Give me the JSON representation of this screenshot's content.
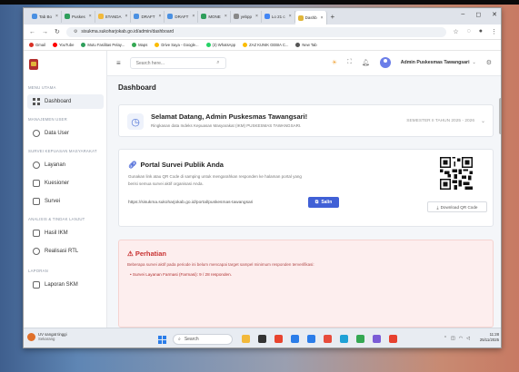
{
  "browser": {
    "tabs": [
      {
        "label": "Tab Bo",
        "active": false
      },
      {
        "label": "Puskes",
        "active": false
      },
      {
        "label": "STANDA",
        "active": false
      },
      {
        "label": "DRAFT",
        "active": false
      },
      {
        "label": "DRAFT",
        "active": false
      },
      {
        "label": "MONE",
        "active": false
      },
      {
        "label": "yebpp",
        "active": false
      },
      {
        "label": "Lo 21 c",
        "active": false
      },
      {
        "label": "Dashb",
        "active": true
      }
    ],
    "url": "sisukma.sukoharjokab.go.id/admin/dashboard",
    "bookmarks": [
      "Gmail",
      "YouTube",
      "Mutu Fasilitas Pelay...",
      "Maps",
      "Drive Saya - Google...",
      "(3) WhatsApp",
      "ZAZ KUNIK GEBIA C...",
      "New Tab"
    ]
  },
  "sidebar": {
    "sections": [
      {
        "heading": "MENU UTAMA",
        "items": [
          {
            "label": "Dashboard",
            "icon": "grid-icon",
            "active": true
          }
        ]
      },
      {
        "heading": "MANAJEMEN USER",
        "items": [
          {
            "label": "Data User",
            "icon": "users-icon",
            "active": false
          }
        ]
      },
      {
        "heading": "SURVEI KEPUASAN MASYARAKAT",
        "items": [
          {
            "label": "Layanan",
            "icon": "service-icon",
            "active": false
          },
          {
            "label": "Kuesioner",
            "icon": "document-icon",
            "active": false
          },
          {
            "label": "Survei",
            "icon": "survey-icon",
            "active": false
          }
        ]
      },
      {
        "heading": "ANALISIS & TINDAK LANJUT",
        "items": [
          {
            "label": "Hasil IKM",
            "icon": "chart-icon",
            "active": false
          },
          {
            "label": "Realisasi RTL",
            "icon": "check-icon",
            "active": false
          }
        ]
      },
      {
        "heading": "LAPORAN",
        "items": [
          {
            "label": "Laporan SKM",
            "icon": "report-icon",
            "active": false
          }
        ]
      }
    ]
  },
  "header": {
    "search_placeholder": "Search here...",
    "user_name": "Admin Puskesmas Tawangsari"
  },
  "main": {
    "page_title": "Dashboard",
    "welcome": {
      "title": "Selamat Datang, Admin Puskesmas Tawangsari!",
      "subtitle": "Ringkasan data Indeks Kepuasan Masyarakat (IKM) PUSKESMAS TAWANGSARI.",
      "semester": "SEMESTER II TAHUN 2025 - 2026"
    },
    "portal": {
      "title": "Portal Survei Publik Anda",
      "desc_line1": "Gunakan link atau QR Code di samping untuk mengarahkan responden ke halaman portal yang",
      "desc_line2": "berisi semua survei aktif organisasi Anda.",
      "url": "https://sisukma.sukoharjokab.go.id/portal/puskesmas-tawangsari",
      "copy_label": "Salin",
      "download_label": "Download QR Code"
    },
    "warning": {
      "title": "Perhatian",
      "desc": "Beberapa survei aktif pada periode ini belum mencapai target sampel minimum responden terverifikasi:",
      "items": [
        "Survei Layanan Farmasi (Farmasi): 9 / 28 responden."
      ]
    }
  },
  "taskbar": {
    "weather_line1": "UV sangat tinggi",
    "weather_line2": "Sekarang",
    "search_label": "Search",
    "time": "11:28",
    "date": "25/11/2025"
  },
  "colors": {
    "accent": "#4060d6",
    "warning": "#c83232",
    "warning_bg": "#fdeeee"
  }
}
